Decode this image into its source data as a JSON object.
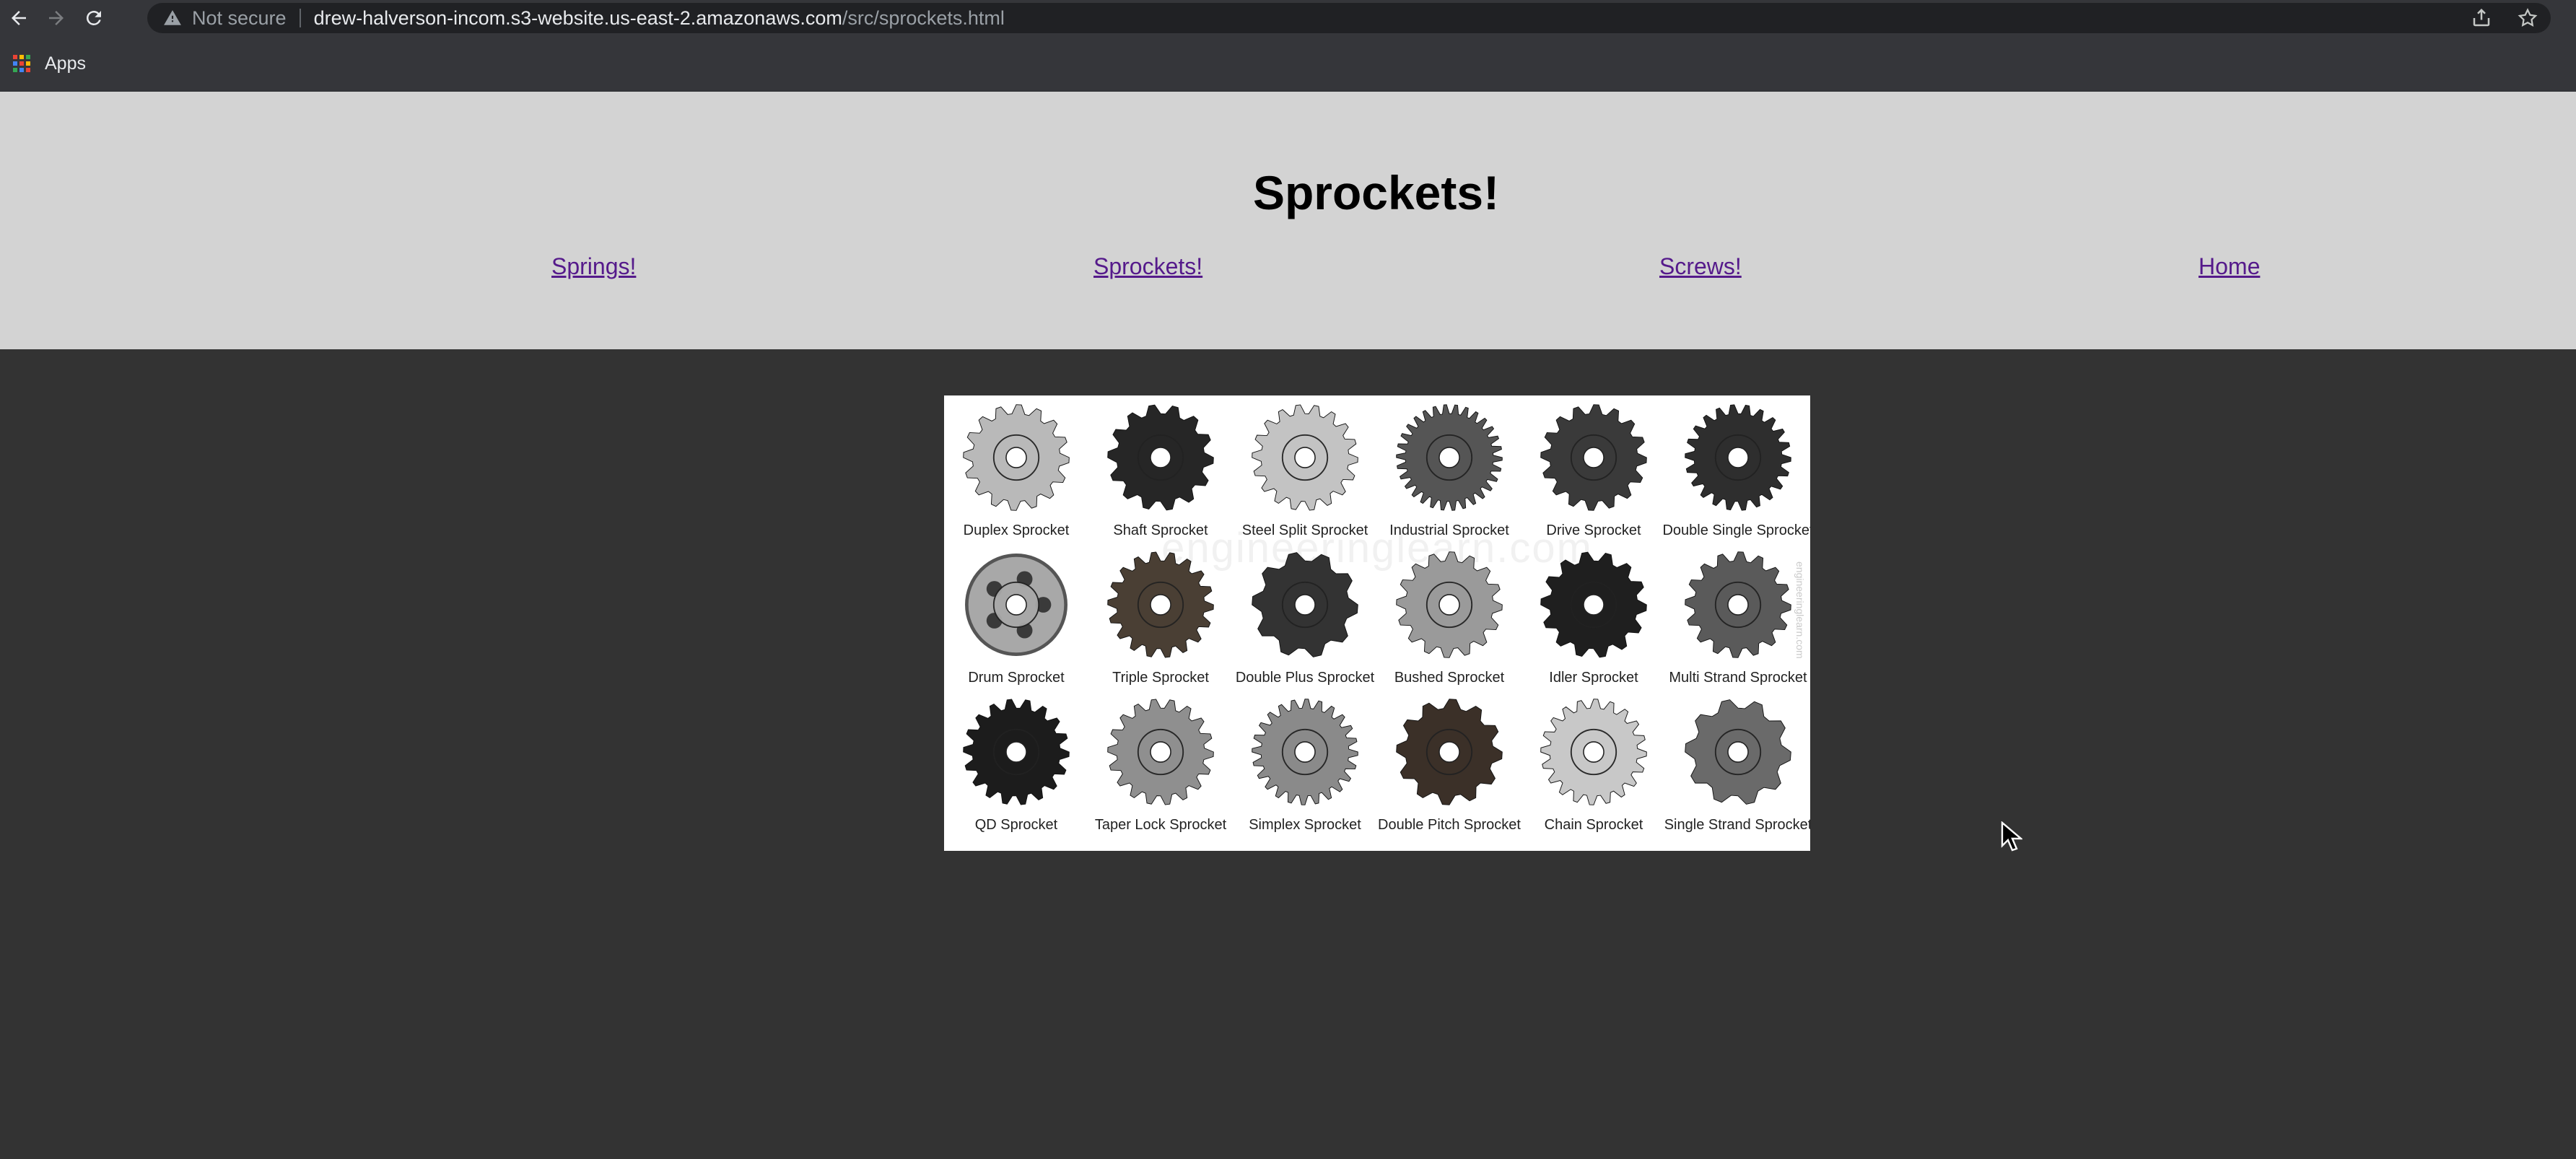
{
  "browser": {
    "security_text": "Not secure",
    "url_host": "drew-halverson-incom.s3-website.us-east-2.amazonaws.com",
    "url_path": "/src/sprockets.html",
    "bookmarks": [
      {
        "label": "Apps"
      }
    ]
  },
  "page": {
    "title": "Sprockets!",
    "nav": [
      {
        "label": "Springs!"
      },
      {
        "label": "Sprockets!"
      },
      {
        "label": "Screws!"
      },
      {
        "label": "Home"
      }
    ]
  },
  "gallery": {
    "watermark": "engineeringlearn.com",
    "side_watermark": "engineeringlearn.com",
    "items": [
      {
        "label": "Duplex Sprocket",
        "color": "#b9b9b9",
        "teeth": 16
      },
      {
        "label": "Shaft Sprocket",
        "color": "#262626",
        "teeth": 14
      },
      {
        "label": "Steel Split Sprocket",
        "color": "#c3c3c3",
        "teeth": 18
      },
      {
        "label": "Industrial Sprocket",
        "color": "#555555",
        "teeth": 30
      },
      {
        "label": "Drive Sprocket",
        "color": "#3a3a3a",
        "teeth": 16
      },
      {
        "label": "Double Single Sprocket",
        "color": "#2e2e2e",
        "teeth": 22
      },
      {
        "label": "Drum Sprocket",
        "color": "#a8a8a8",
        "teeth": 0
      },
      {
        "label": "Triple Sprocket",
        "color": "#4a3f34",
        "teeth": 18
      },
      {
        "label": "Double Plus Sprocket",
        "color": "#333333",
        "teeth": 10
      },
      {
        "label": "Bushed Sprocket",
        "color": "#9a9a9a",
        "teeth": 16
      },
      {
        "label": "Idler Sprocket",
        "color": "#1f1f1f",
        "teeth": 14
      },
      {
        "label": "Multi Strand Sprocket",
        "color": "#5a5a5a",
        "teeth": 16
      },
      {
        "label": "QD Sprocket",
        "color": "#1c1c1c",
        "teeth": 18
      },
      {
        "label": "Taper Lock Sprocket",
        "color": "#8f8f8f",
        "teeth": 18
      },
      {
        "label": "Simplex Sprocket",
        "color": "#8a8a8a",
        "teeth": 24
      },
      {
        "label": "Double Pitch Sprocket",
        "color": "#3b3028",
        "teeth": 12
      },
      {
        "label": "Chain Sprocket",
        "color": "#c8c8c8",
        "teeth": 20
      },
      {
        "label": "Single Strand Sprocket",
        "color": "#6a6a6a",
        "teeth": 10
      }
    ]
  }
}
